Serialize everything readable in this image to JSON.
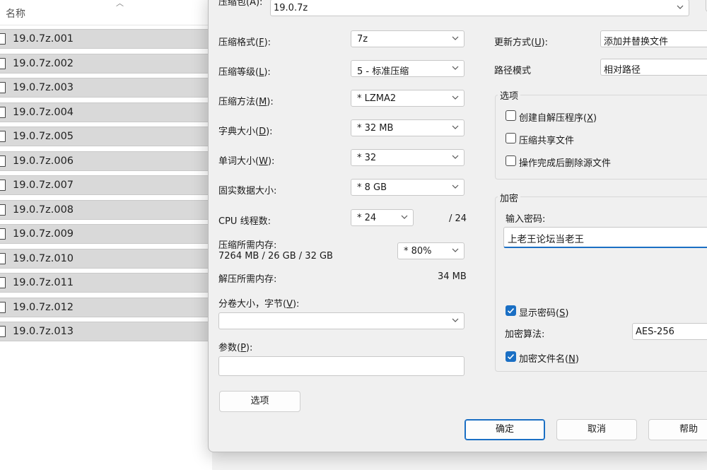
{
  "explorer": {
    "column_header": "名称",
    "files": [
      "19.0.7z.001",
      "19.0.7z.002",
      "19.0.7z.003",
      "19.0.7z.004",
      "19.0.7z.005",
      "19.0.7z.006",
      "19.0.7z.007",
      "19.0.7z.008",
      "19.0.7z.009",
      "19.0.7z.010",
      "19.0.7z.011",
      "19.0.7z.012",
      "19.0.7z.013"
    ]
  },
  "dialog": {
    "archive": {
      "label": "压缩包(A):",
      "value": "19.0.7z"
    },
    "left": {
      "format": {
        "label": "压缩格式(F):",
        "value": "7z"
      },
      "level": {
        "label": "压缩等级(L):",
        "value": "5 - 标准压缩"
      },
      "method": {
        "label": "压缩方法(M):",
        "value": "*  LZMA2"
      },
      "dict": {
        "label": "字典大小(D):",
        "value": "*  32 MB"
      },
      "word": {
        "label": "单词大小(W):",
        "value": "*  32"
      },
      "solid": {
        "label": "固实数据大小:",
        "value": "*  8 GB"
      },
      "cpu": {
        "label": "CPU 线程数:",
        "value": "*  24",
        "max": "/ 24"
      },
      "mem_comp": {
        "label": "压缩所需内存:",
        "detail": "7264 MB / 26 GB / 32 GB",
        "value": "*  80%"
      },
      "mem_decomp": {
        "label": "解压所需内存:",
        "value": "34 MB"
      },
      "volume": {
        "label": "分卷大小，字节(V):",
        "value": ""
      },
      "params": {
        "label": "参数(P):",
        "value": ""
      },
      "options_button": "选项"
    },
    "right": {
      "update": {
        "label": "更新方式(U):",
        "value": "添加并替换文件"
      },
      "path": {
        "label": "路径模式",
        "value": "相对路径"
      },
      "options_group": {
        "title": "选项",
        "items": [
          {
            "label": "创建自解压程序(X)",
            "checked": false
          },
          {
            "label": "压缩共享文件",
            "checked": false
          },
          {
            "label": "操作完成后删除源文件",
            "checked": false
          }
        ]
      },
      "encryption": {
        "title": "加密",
        "password_label": "输入密码:",
        "password_value": "上老王论坛当老王",
        "show_password": {
          "label": "显示密码(S)",
          "checked": true
        },
        "algorithm_label": "加密算法:",
        "algorithm_value": "AES-256",
        "encrypt_names": {
          "label": "加密文件名(N)",
          "checked": true
        }
      }
    },
    "buttons": {
      "ok": "确定",
      "cancel": "取消",
      "help": "帮助"
    }
  },
  "colors": {
    "accent": "#1a6fc4",
    "row_selected": "#d9d9d9",
    "dialog_bg": "#f0f0f0"
  }
}
